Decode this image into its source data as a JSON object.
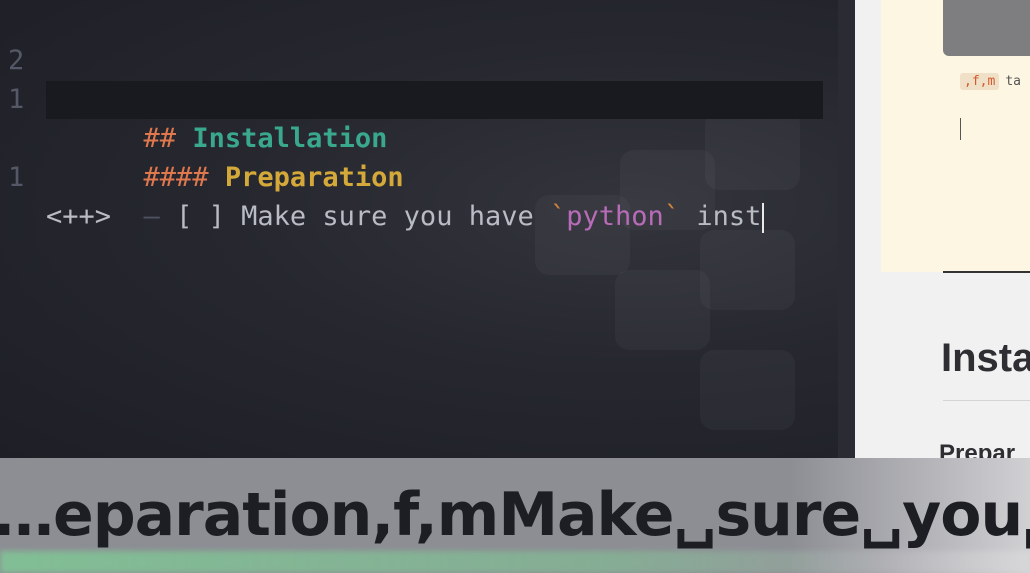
{
  "editor": {
    "lines": [
      {
        "number": "2",
        "marker": "##",
        "text": "Installation"
      },
      {
        "number": "1",
        "marker": "####",
        "text": "Preparation"
      },
      {
        "number": "",
        "bullet": "–",
        "checkbox": "[ ]",
        "text_before": "Make sure you have",
        "backtick_open": "`",
        "code": "python",
        "backtick_close": "`",
        "text_after": "inst"
      },
      {
        "number": "1",
        "text": "<++>"
      }
    ]
  },
  "preview": {
    "shortcut_key": ",f,m",
    "shortcut_text_fragment": "ta",
    "heading_fragment": "Insta",
    "subheading_fragment": "Prepar"
  },
  "key_overlay": {
    "text": "…eparation,f,mMake␣sure␣you␣"
  }
}
